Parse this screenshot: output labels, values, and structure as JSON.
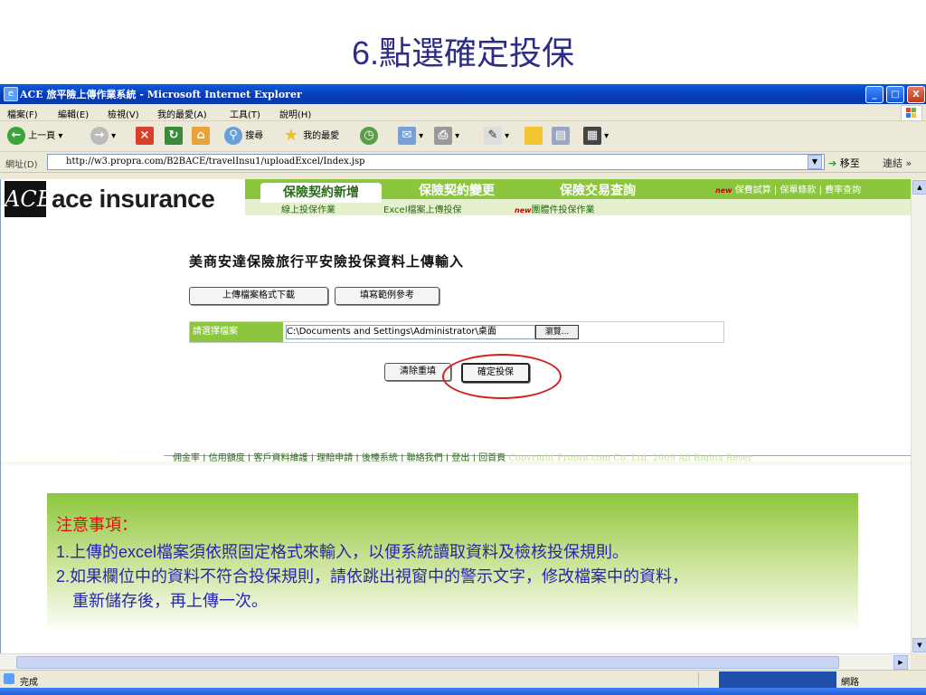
{
  "slide_title": "6.點選確定投保",
  "window": {
    "title": "ACE 旅平險上傳作業系統 - Microsoft Internet Explorer",
    "controls": [
      "_",
      "□",
      "X"
    ]
  },
  "menu": [
    "檔案(F)",
    "編輯(E)",
    "檢視(V)",
    "我的最愛(A)",
    "工具(T)",
    "說明(H)"
  ],
  "toolbar": {
    "back": "上一頁",
    "search": "搜尋",
    "favorites": "我的最愛"
  },
  "address": {
    "label": "網址(D)",
    "url": "http://w3.propra.com/B2BACE/travelInsu1/uploadExcel/Index.jsp",
    "go": "移至",
    "links": "連結"
  },
  "site": {
    "logo_text": "ace insurance",
    "logo_mark": "ACE",
    "nav_tabs": [
      "保險契約新增",
      "保險契約變更",
      "保險交易查詢"
    ],
    "new_badge": "new",
    "top_links": [
      "保費試算",
      "保單條款",
      "費率查詢"
    ],
    "subnav": [
      "線上投保作業",
      "Excel檔案上傳投保",
      "團體件投保作業"
    ],
    "page_heading": "美商安達保險旅行平安險投保資料上傳輸入",
    "download_button": "上傳檔案格式下載",
    "sample_button": "填寫範例參考",
    "file_label": "請選擇檔案",
    "file_value": "C:\\Documents and Settings\\Administrator\\桌面",
    "browse_button": "瀏覽...",
    "reset_button": "清除重填",
    "confirm_button": "確定投保",
    "footer_links": [
      "佣金率",
      "信用額度",
      "客戶資料維護",
      "理賠申請",
      "後檯系統",
      "聯絡我們",
      "登出",
      "回首頁"
    ],
    "copyright": "Copyright Propra.com Co. Ltd. 2009 All Rights Reser"
  },
  "status": {
    "text": "完成",
    "zone": "網路"
  },
  "note": {
    "title": "注意事項：",
    "line1_num": "1.",
    "line1_a": "上傳的",
    "line1_b": "excel",
    "line1_c": "檔案須依照固定格式來輸入，以便系統讀取資料及檢核投保規則。",
    "line2_num": "2.",
    "line2_a": "如果欄位中的資料不符合投保規則，請依跳出視窗中的警示文字，修改檔案中的資料，",
    "line2_b": "重新儲存後，再上傳一次。"
  }
}
